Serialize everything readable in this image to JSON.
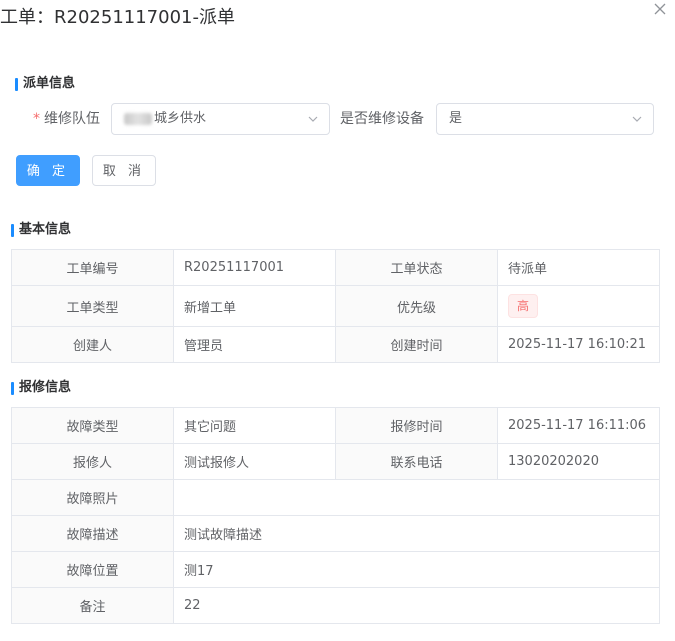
{
  "dialog": {
    "title": "工单：R20251117001-派单"
  },
  "dispatch": {
    "section_title": "派单信息",
    "team_label": "维修队伍",
    "team_required_mark": "*",
    "team_value": "城乡供水",
    "equip_label": "是否维修设备",
    "equip_value": "是",
    "confirm_label": "确 定",
    "cancel_label": "取 消"
  },
  "basic": {
    "section_title": "基本信息",
    "rows": [
      [
        {
          "k": "工单编号",
          "v": "R20251117001"
        },
        {
          "k": "工单状态",
          "v": "待派单"
        }
      ],
      [
        {
          "k": "工单类型",
          "v": "新增工单"
        },
        {
          "k": "优先级",
          "v": "高"
        }
      ],
      [
        {
          "k": "创建人",
          "v": "管理员"
        },
        {
          "k": "创建时间",
          "v": "2025-11-17 16:10:21"
        }
      ]
    ]
  },
  "repair": {
    "section_title": "报修信息",
    "rows": [
      [
        {
          "k": "故障类型",
          "v": "其它问题"
        },
        {
          "k": "报修时间",
          "v": "2025-11-17 16:11:06"
        }
      ],
      [
        {
          "k": "报修人",
          "v": "测试报修人"
        },
        {
          "k": "联系电话",
          "v": "13020202020"
        }
      ],
      [
        {
          "k": "故障照片",
          "v": ""
        }
      ],
      [
        {
          "k": "故障描述",
          "v": "测试故障描述"
        }
      ],
      [
        {
          "k": "故障位置",
          "v": "测17"
        }
      ],
      [
        {
          "k": "备注",
          "v": "22"
        }
      ]
    ]
  },
  "colors": {
    "accent": "#409eff",
    "section_bar": "#1a8cff",
    "danger": "#f56c6c"
  },
  "icons": {
    "close": "close-icon",
    "dropdown": "chevron-down-icon"
  }
}
